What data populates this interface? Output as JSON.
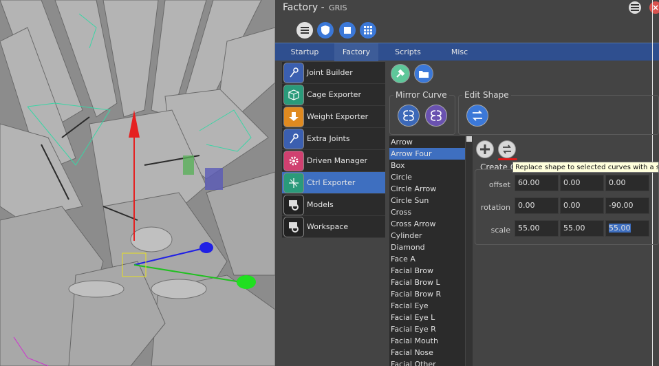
{
  "window": {
    "title": "Factory",
    "subtitle": "GRIS",
    "close_label": "×"
  },
  "toolbar_icons": [
    "list-icon",
    "shield-icon",
    "square-icon",
    "grid-icon"
  ],
  "tabs": [
    {
      "label": "Startup"
    },
    {
      "label": "Factory",
      "active": true
    },
    {
      "label": "Scripts"
    },
    {
      "label": "Misc"
    }
  ],
  "nav": {
    "items": [
      {
        "label": "Joint Builder",
        "icon": "joint-icon",
        "color": "#3b5fb0"
      },
      {
        "label": "Cage Exporter",
        "icon": "cube-icon",
        "color": "#2a9a7a"
      },
      {
        "label": "Weight Exporter",
        "icon": "download-icon",
        "color": "#e08a20"
      },
      {
        "label": "Extra Joints",
        "icon": "joint-icon",
        "color": "#3b5fb0"
      },
      {
        "label": "Driven Manager",
        "icon": "gear-icon",
        "color": "#d04070"
      },
      {
        "label": "Ctrl Exporter",
        "icon": "crosshair-icon",
        "color": "#2a9a7a",
        "selected": true
      },
      {
        "label": "Models",
        "icon": "script-icon",
        "color": "#222222"
      },
      {
        "label": "Workspace",
        "icon": "script-icon",
        "color": "#222222"
      }
    ]
  },
  "groups": {
    "mirror_curve": "Mirror Curve",
    "edit_shape": "Edit Shape"
  },
  "shapes": {
    "items": [
      "Arrow",
      "Arrow Four",
      "Box",
      "Circle",
      "Circle Arrow",
      "Circle Sun",
      "Cross",
      "Cross Arrow",
      "Cylinder",
      "Diamond",
      "Face A",
      "Facial Brow",
      "Facial Brow L",
      "Facial Brow R",
      "Facial Eye",
      "Facial Eye L",
      "Facial Eye R",
      "Facial Mouth",
      "Facial Nose",
      "Facial Other"
    ],
    "selected": "Arrow Four"
  },
  "transform": {
    "create_label": "Create C",
    "rows": [
      {
        "label": "offset",
        "values": [
          "60.00",
          "0.00",
          "0.00"
        ]
      },
      {
        "label": "rotation",
        "values": [
          "0.00",
          "0.00",
          "-90.00"
        ]
      },
      {
        "label": "scale",
        "values": [
          "55.00",
          "55.00",
          "55.00"
        ]
      }
    ]
  },
  "tooltip": "Replace shape to selected curves with a s"
}
